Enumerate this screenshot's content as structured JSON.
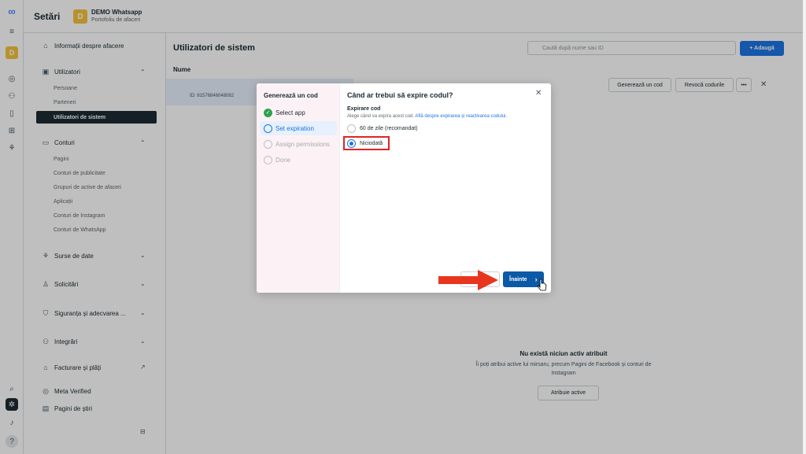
{
  "app": {
    "title": "Setări",
    "business": {
      "initial": "D",
      "name": "DEMO Whatsapp",
      "subtitle": "Portofoliu de afaceri"
    }
  },
  "sidebar": {
    "business_info": "Informații despre afacere",
    "users_section": "Utilizatori",
    "users_items": [
      "Persoane",
      "Parteneri",
      "Utilizatori de sistem"
    ],
    "accounts_section": "Conturi",
    "accounts_items": [
      "Pagini",
      "Conturi de publicitate",
      "Grupuri de active de afaceri",
      "Aplicații",
      "Conturi de Instagram",
      "Conturi de WhatsApp"
    ],
    "data_sources": "Surse de date",
    "requests": "Solicitări",
    "safety": "Siguranța și adecvarea ...",
    "integrations": "Integrări",
    "billing": "Facturare și plăți",
    "meta_verified": "Meta Verified",
    "news": "Pagini de știri"
  },
  "main": {
    "title": "Utilizatori de sistem",
    "search_placeholder": "Caută după nume sau ID",
    "add_button": "+ Adaugă",
    "name_column": "Nume",
    "user_id": "ID: 61576846048082",
    "generate_token": "Generează un cod",
    "revoke_tokens": "Revocă codurile",
    "more": "•••",
    "empty_title": "Nu există niciun activ atribuit",
    "empty_desc": "Îi poți atribui active lui mirsaru, precum Pagini de Facebook și conturi de Instagram",
    "assign_button": "Atribuie active"
  },
  "modal": {
    "steps_title": "Generează un cod",
    "steps": [
      "Select app",
      "Set expiration",
      "Assign permissions",
      "Done"
    ],
    "question": "Când ar trebui să expire codul?",
    "expiration_label": "Expirare cod",
    "help_text": "Alege când va expira acest cod.",
    "help_link": "Află despre expirarea și reactivarea codului.",
    "options": [
      "60 de zile (recomandat)",
      "Niciodată"
    ],
    "selected_option": "Niciodată",
    "next_button": "Înainte"
  },
  "colors": {
    "accent": "#1b74e4",
    "highlight": "#e02424",
    "arrow": "#e8361e",
    "brand_avatar": "#f5c33b"
  }
}
